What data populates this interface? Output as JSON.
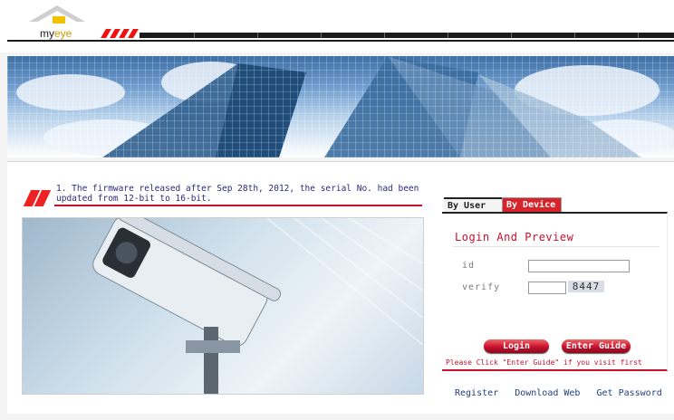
{
  "header": {
    "logo_text": "my",
    "logo_text_accent": "eye"
  },
  "notice": {
    "text": "1. The firmware released after Sep 28th, 2012, the serial No. had been updated from 12-bit to 16-bit."
  },
  "tabs": {
    "by_user": "By User",
    "by_device": "By Device"
  },
  "login": {
    "title": "Login And Preview",
    "id_label": "id",
    "verify_label": "verify",
    "id_value": "",
    "verify_value": "",
    "captcha": "8447",
    "login_button": "Login",
    "guide_button": "Enter Guide",
    "hint": "Please Click \"Enter Guide\" if you visit first"
  },
  "links": {
    "register": "Register",
    "download": "Download Web",
    "password": "Get Password"
  },
  "colors": {
    "accent": "#c8102e",
    "link": "#1d3f7f"
  }
}
